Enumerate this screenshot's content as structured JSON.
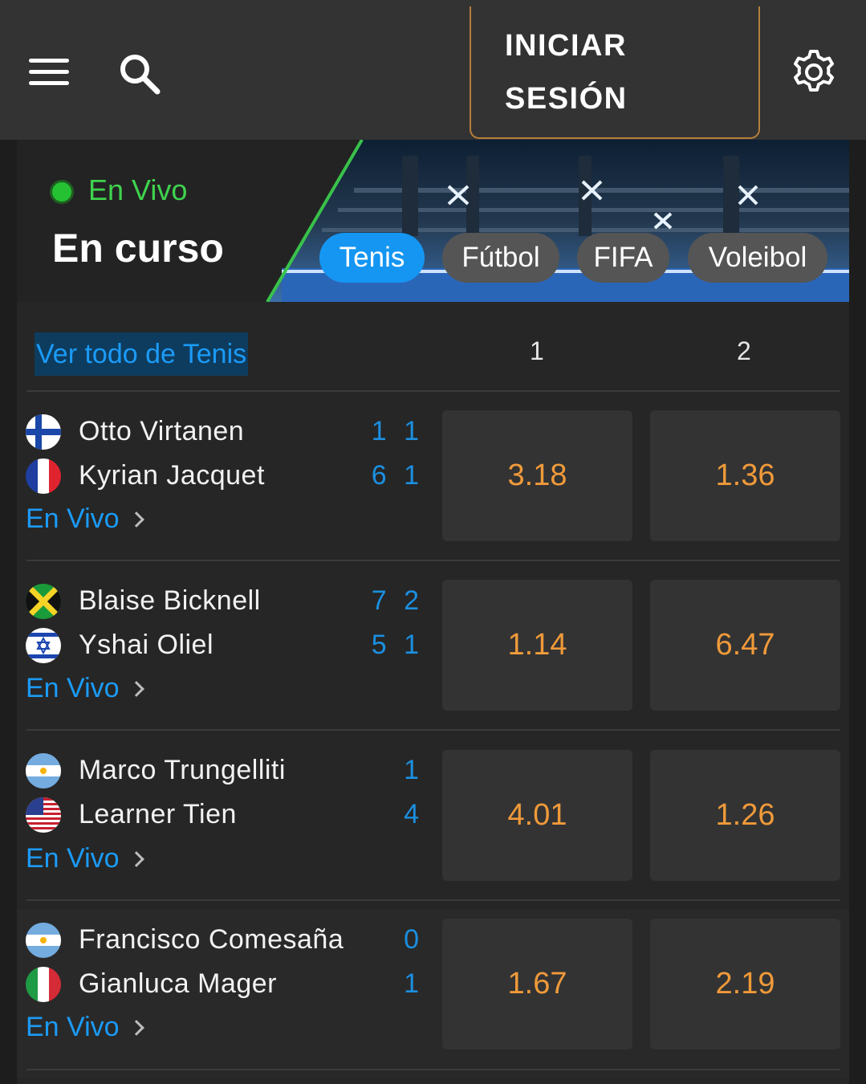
{
  "header": {
    "login_line1": "INICIAR",
    "login_line2": "SESIÓN",
    "icons": [
      "menu-icon",
      "search-icon",
      "gear-icon"
    ]
  },
  "hero": {
    "live_label": "En Vivo",
    "title": "En curso",
    "tabs": [
      {
        "label": "Tenis",
        "active": true
      },
      {
        "label": "Fútbol",
        "active": false
      },
      {
        "label": "FIFA",
        "active": false
      },
      {
        "label": "Voleibol",
        "active": false
      }
    ]
  },
  "list": {
    "see_all": "Ver todo de Tenis",
    "col1": "1",
    "col2": "2",
    "matches": [
      {
        "p1": "Otto Virtanen",
        "p1_flag": "finland-flag-icon",
        "p1_score": "1 1",
        "p2": "Kyrian Jacquet",
        "p2_flag": "france-flag-icon",
        "p2_score": "6 1",
        "live": "En Vivo",
        "odd1": "3.18",
        "odd2": "1.36"
      },
      {
        "p1": "Blaise Bicknell",
        "p1_flag": "jamaica-flag-icon",
        "p1_score": "7 2",
        "p2": "Yshai Oliel",
        "p2_flag": "israel-flag-icon",
        "p2_score": "5 1",
        "live": "En Vivo",
        "odd1": "1.14",
        "odd2": "6.47"
      },
      {
        "p1": "Marco Trungelliti",
        "p1_flag": "argentina-flag-icon",
        "p1_score": "1",
        "p2": "Learner Tien",
        "p2_flag": "usa-flag-icon",
        "p2_score": "4",
        "live": "En Vivo",
        "odd1": "4.01",
        "odd2": "1.26"
      },
      {
        "p1": "Francisco Comesaña",
        "p1_flag": "argentina-flag-icon",
        "p1_score": "0",
        "p2": "Gianluca Mager",
        "p2_flag": "italy-flag-icon",
        "p2_score": "1",
        "live": "En Vivo",
        "odd1": "1.67",
        "odd2": "2.19"
      }
    ]
  },
  "colors": {
    "accent": "#1596f2",
    "odds": "#f09a3a",
    "live_green": "#3fd34e",
    "login_border": "#b57f3b"
  }
}
